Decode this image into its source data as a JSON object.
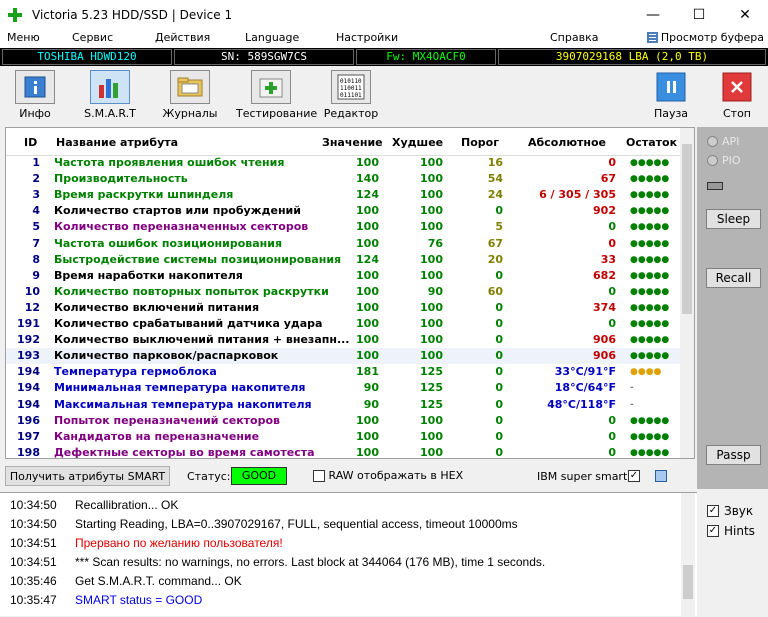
{
  "window": {
    "title": "Victoria 5.23 HDD/SSD | Device 1"
  },
  "menu": {
    "items": [
      "Меню",
      "Сервис",
      "Действия",
      "Language",
      "Настройки",
      "Справка"
    ],
    "buffer_view": "Просмотр буфера"
  },
  "drive": {
    "model": "TOSHIBA HDWD120",
    "serial": "SN: 589SGW7CS",
    "firmware": "Fw: MX4OACF0",
    "capacity": "3907029168 LBA (2,0 TB)"
  },
  "toolbar": {
    "buttons": [
      "Инфо",
      "S.M.A.R.T",
      "Журналы",
      "Тестирование",
      "Редактор"
    ],
    "pause": "Пауза",
    "stop": "Стоп"
  },
  "smart": {
    "headers": [
      "ID",
      "Название атрибута",
      "Значение",
      "Худшее",
      "Порог",
      "Абсолютное",
      "Остаток"
    ],
    "rows": [
      {
        "id": "1",
        "name": "Частота проявления ошибок чтения",
        "value": "100",
        "worst": "100",
        "thresh": "16",
        "abs": "0",
        "rem": "●●●●●",
        "name_color": "#008000",
        "abs_color": "#c00000",
        "thr_color": "#808000",
        "rem_color": "#008000"
      },
      {
        "id": "2",
        "name": "Производительность",
        "value": "140",
        "worst": "100",
        "thresh": "54",
        "abs": "67",
        "rem": "●●●●●",
        "name_color": "#008000",
        "abs_color": "#c00000",
        "thr_color": "#808000",
        "rem_color": "#008000"
      },
      {
        "id": "3",
        "name": "Время раскрутки шпинделя",
        "value": "124",
        "worst": "100",
        "thresh": "24",
        "abs": "6 / 305 / 305",
        "rem": "●●●●●",
        "name_color": "#008000",
        "abs_color": "#c00000",
        "thr_color": "#808000",
        "rem_color": "#008000"
      },
      {
        "id": "4",
        "name": "Количество стартов или пробуждений",
        "value": "100",
        "worst": "100",
        "thresh": "0",
        "abs": "902",
        "rem": "●●●●●",
        "name_color": "#000000",
        "abs_color": "#c00000",
        "thr_color": "#008000",
        "rem_color": "#008000"
      },
      {
        "id": "5",
        "name": "Количество переназначенных секторов",
        "value": "100",
        "worst": "100",
        "thresh": "5",
        "abs": "0",
        "rem": "●●●●●",
        "name_color": "#800080",
        "abs_color": "#008000",
        "thr_color": "#808000",
        "rem_color": "#008000"
      },
      {
        "id": "7",
        "name": "Частота ошибок позиционирования",
        "value": "100",
        "worst": "76",
        "thresh": "67",
        "abs": "0",
        "rem": "●●●●●",
        "name_color": "#008000",
        "abs_color": "#c00000",
        "thr_color": "#808000",
        "rem_color": "#008000"
      },
      {
        "id": "8",
        "name": "Быстродействие системы позиционирования",
        "value": "124",
        "worst": "100",
        "thresh": "20",
        "abs": "33",
        "rem": "●●●●●",
        "name_color": "#008000",
        "abs_color": "#c00000",
        "thr_color": "#808000",
        "rem_color": "#008000"
      },
      {
        "id": "9",
        "name": "Время наработки накопителя",
        "value": "100",
        "worst": "100",
        "thresh": "0",
        "abs": "682",
        "rem": "●●●●●",
        "name_color": "#000000",
        "abs_color": "#c00000",
        "thr_color": "#008000",
        "rem_color": "#008000"
      },
      {
        "id": "10",
        "name": "Количество повторных попыток раскрутки",
        "value": "100",
        "worst": "90",
        "thresh": "60",
        "abs": "0",
        "rem": "●●●●●",
        "name_color": "#008000",
        "abs_color": "#008000",
        "thr_color": "#808000",
        "rem_color": "#008000"
      },
      {
        "id": "12",
        "name": "Количество включений питания",
        "value": "100",
        "worst": "100",
        "thresh": "0",
        "abs": "374",
        "rem": "●●●●●",
        "name_color": "#000000",
        "abs_color": "#c00000",
        "thr_color": "#008000",
        "rem_color": "#008000"
      },
      {
        "id": "191",
        "name": "Количество срабатываний датчика удара",
        "value": "100",
        "worst": "100",
        "thresh": "0",
        "abs": "0",
        "rem": "●●●●●",
        "name_color": "#000000",
        "abs_color": "#008000",
        "thr_color": "#008000",
        "rem_color": "#008000"
      },
      {
        "id": "192",
        "name": "Количество выключений питания + внезапн...",
        "value": "100",
        "worst": "100",
        "thresh": "0",
        "abs": "906",
        "rem": "●●●●●",
        "name_color": "#000000",
        "abs_color": "#c00000",
        "thr_color": "#008000",
        "rem_color": "#008000"
      },
      {
        "id": "193",
        "name": "Количество парковок/распарковок",
        "value": "100",
        "worst": "100",
        "thresh": "0",
        "abs": "906",
        "rem": "●●●●●",
        "name_color": "#000000",
        "abs_color": "#c00000",
        "thr_color": "#008000",
        "rem_color": "#008000"
      },
      {
        "id": "194",
        "name": "Температура гермоблока",
        "value": "181",
        "worst": "125",
        "thresh": "0",
        "abs": "33°C/91°F",
        "rem": "●●●●",
        "name_color": "#0000c0",
        "abs_color": "#0000c0",
        "thr_color": "#008000",
        "rem_color": "#e0a000"
      },
      {
        "id": "194",
        "name": "Минимальная температура накопителя",
        "value": "90",
        "worst": "125",
        "thresh": "0",
        "abs": "18°C/64°F",
        "rem": "-",
        "name_color": "#0000c0",
        "abs_color": "#0000c0",
        "thr_color": "#008000",
        "rem_color": "#808080"
      },
      {
        "id": "194",
        "name": "Максимальная температура накопителя",
        "value": "90",
        "worst": "125",
        "thresh": "0",
        "abs": "48°C/118°F",
        "rem": "-",
        "name_color": "#0000c0",
        "abs_color": "#0000c0",
        "thr_color": "#008000",
        "rem_color": "#808080"
      },
      {
        "id": "196",
        "name": "Попыток переназначений секторов",
        "value": "100",
        "worst": "100",
        "thresh": "0",
        "abs": "0",
        "rem": "●●●●●",
        "name_color": "#800080",
        "abs_color": "#008000",
        "thr_color": "#008000",
        "rem_color": "#008000"
      },
      {
        "id": "197",
        "name": "Кандидатов на переназначение",
        "value": "100",
        "worst": "100",
        "thresh": "0",
        "abs": "0",
        "rem": "●●●●●",
        "name_color": "#800080",
        "abs_color": "#008000",
        "thr_color": "#008000",
        "rem_color": "#008000"
      },
      {
        "id": "198",
        "name": "Дефектные секторы во время самотеста",
        "value": "100",
        "worst": "100",
        "thresh": "0",
        "abs": "0",
        "rem": "●●●●●",
        "name_color": "#800080",
        "abs_color": "#008000",
        "thr_color": "#008000",
        "rem_color": "#008000"
      }
    ]
  },
  "status": {
    "get_smart": "Получить атрибуты SMART",
    "status_label": "Статус:",
    "status_value": "GOOD",
    "raw_hex": "RAW отображать в HEX",
    "ibm": "IBM super smart:"
  },
  "side": {
    "api": "API",
    "pio": "PIO",
    "sleep": "Sleep",
    "recall": "Recall",
    "passp": "Passp"
  },
  "log": [
    {
      "time": "10:34:50",
      "msg": "Recallibration... OK",
      "color": "#000000"
    },
    {
      "time": "10:34:50",
      "msg": "Starting Reading, LBA=0..3907029167, FULL, sequential access, timeout 10000ms",
      "color": "#000000"
    },
    {
      "time": "10:34:51",
      "msg": "Прервано по желанию пользователя!",
      "color": "#e00000"
    },
    {
      "time": "10:34:51",
      "msg": "*** Scan results: no warnings, no errors. Last block at 344064 (176 MB), time 1 seconds.",
      "color": "#000000"
    },
    {
      "time": "10:35:46",
      "msg": "Get S.M.A.R.T. command... OK",
      "color": "#000000"
    },
    {
      "time": "10:35:47",
      "msg": "SMART status = GOOD",
      "color": "#0000e0"
    }
  ],
  "options": {
    "sound": "Звук",
    "hints": "Hints"
  },
  "colors": {
    "drive_model": "#00ffff",
    "drive_fw": "#00ff00",
    "drive_cap": "#ffff00",
    "status_good": "#00ff00"
  }
}
